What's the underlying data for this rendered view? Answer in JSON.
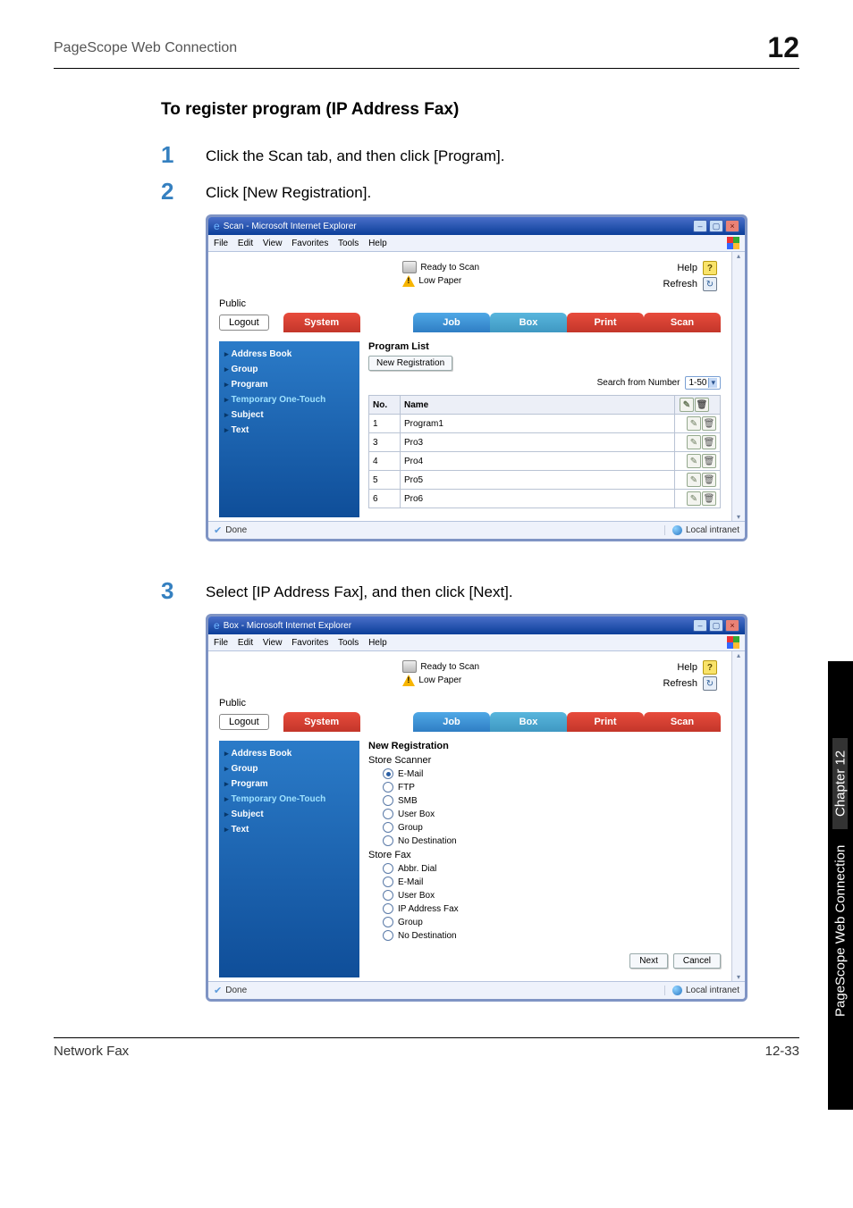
{
  "header": {
    "left": "PageScope Web Connection",
    "right": "12"
  },
  "section_title": "To register program (IP Address Fax)",
  "steps": {
    "s1": {
      "num": "1",
      "text": "Click the Scan tab, and then click [Program]."
    },
    "s2": {
      "num": "2",
      "text": "Click [New Registration]."
    },
    "s3": {
      "num": "3",
      "text": "Select [IP Address Fax], and then click [Next]."
    }
  },
  "browser1": {
    "title": "Scan - Microsoft Internet Explorer",
    "menu": {
      "file": "File",
      "edit": "Edit",
      "view": "View",
      "favorites": "Favorites",
      "tools": "Tools",
      "help": "Help"
    },
    "status": {
      "ready": "Ready to Scan",
      "low": "Low Paper",
      "help": "Help",
      "refresh": "Refresh"
    },
    "public": "Public",
    "logout": "Logout",
    "tabs": {
      "system": "System",
      "job": "Job",
      "box": "Box",
      "print": "Print",
      "scan": "Scan"
    },
    "sidebar": {
      "addr": "Address Book",
      "group": "Group",
      "program": "Program",
      "temp": "Temporary One-Touch",
      "subject": "Subject",
      "text": "Text"
    },
    "pane": {
      "title": "Program List",
      "newreg": "New Registration",
      "search_label": "Search from Number",
      "range": "1-50",
      "cols": {
        "no": "No.",
        "name": "Name"
      },
      "rows": [
        {
          "no": "1",
          "name": "Program1"
        },
        {
          "no": "3",
          "name": "Pro3"
        },
        {
          "no": "4",
          "name": "Pro4"
        },
        {
          "no": "5",
          "name": "Pro5"
        },
        {
          "no": "6",
          "name": "Pro6"
        }
      ]
    },
    "statusbar": {
      "done": "Done",
      "zone": "Local intranet"
    }
  },
  "browser2": {
    "title": "Box - Microsoft Internet Explorer",
    "pane": {
      "title": "New Registration",
      "store_scanner": "Store Scanner",
      "scanner_opts": [
        "E-Mail",
        "FTP",
        "SMB",
        "User Box",
        "Group",
        "No Destination"
      ],
      "store_fax": "Store Fax",
      "fax_opts": [
        "Abbr. Dial",
        "E-Mail",
        "User Box",
        "IP Address Fax",
        "Group",
        "No Destination"
      ],
      "next": "Next",
      "cancel": "Cancel"
    }
  },
  "side_tab": {
    "label": "PageScope Web Connection",
    "chapter": "Chapter 12"
  },
  "footer": {
    "left": "Network Fax",
    "right": "12-33"
  }
}
